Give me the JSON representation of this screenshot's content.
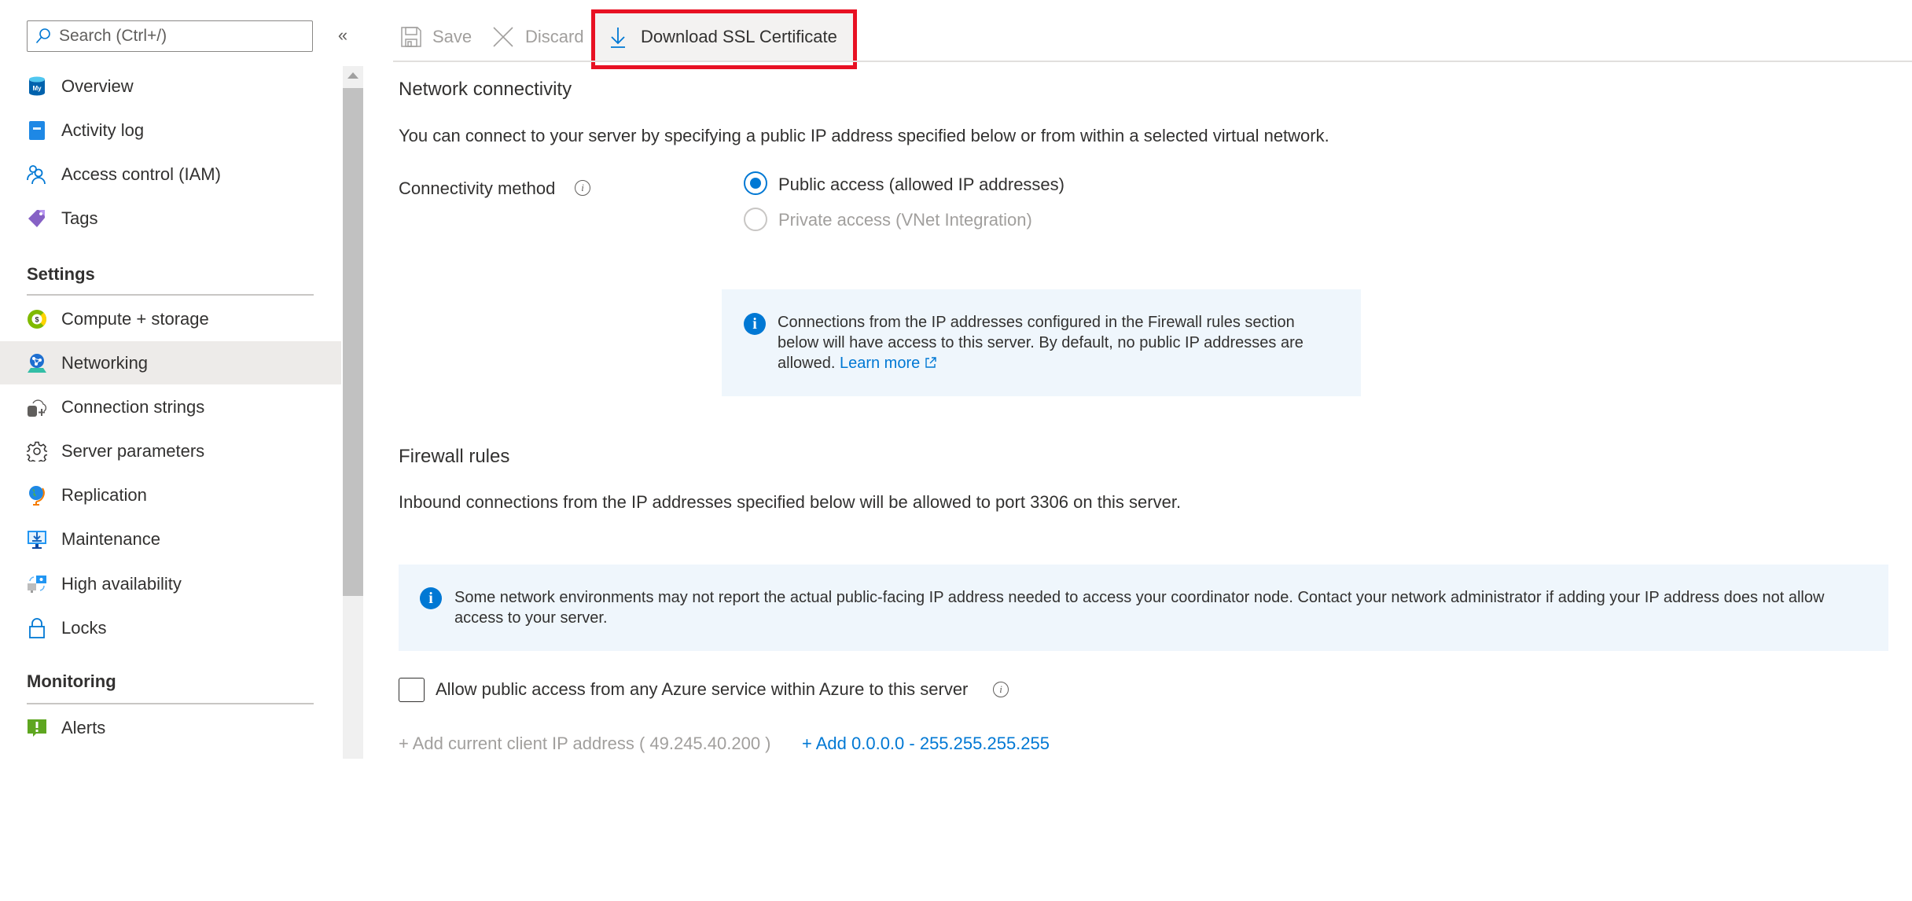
{
  "sidebar": {
    "search_placeholder": "Search (Ctrl+/)",
    "collapse_glyph": "«",
    "items_top": [
      {
        "label": "Overview",
        "icon": "mysql-database-icon"
      },
      {
        "label": "Activity log",
        "icon": "activity-log-icon"
      },
      {
        "label": "Access control (IAM)",
        "icon": "people-icon"
      },
      {
        "label": "Tags",
        "icon": "tag-icon"
      }
    ],
    "settings_heading": "Settings",
    "settings_items": [
      {
        "label": "Compute + storage",
        "icon": "compute-storage-icon"
      },
      {
        "label": "Networking",
        "icon": "networking-icon",
        "active": true
      },
      {
        "label": "Connection strings",
        "icon": "connection-strings-icon"
      },
      {
        "label": "Server parameters",
        "icon": "gear-icon"
      },
      {
        "label": "Replication",
        "icon": "globe-icon"
      },
      {
        "label": "Maintenance",
        "icon": "maintenance-icon"
      },
      {
        "label": "High availability",
        "icon": "high-availability-icon"
      },
      {
        "label": "Locks",
        "icon": "lock-icon"
      }
    ],
    "monitoring_heading": "Monitoring",
    "monitoring_items": [
      {
        "label": "Alerts",
        "icon": "alert-icon"
      }
    ]
  },
  "toolbar": {
    "save_label": "Save",
    "discard_label": "Discard",
    "download_label": "Download SSL Certificate"
  },
  "network": {
    "title": "Network connectivity",
    "description": "You can connect to your server by specifying a public IP address specified below or from within a selected virtual network.",
    "method_label": "Connectivity method",
    "options": [
      {
        "label": "Public access (allowed IP addresses)",
        "selected": true,
        "disabled": false
      },
      {
        "label": "Private access (VNet Integration)",
        "selected": false,
        "disabled": true
      }
    ],
    "info_text": "Connections from the IP addresses configured in the Firewall rules section below will have access to this server. By default, no public IP addresses are allowed.",
    "learn_more": "Learn more"
  },
  "firewall": {
    "title": "Firewall rules",
    "description": "Inbound connections from the IP addresses specified below will be allowed to port 3306 on this server.",
    "warning_text": "Some network environments may not report the actual public-facing IP address needed to access your coordinator node. Contact your network administrator if adding your IP address does not allow access to your server.",
    "allow_azure_label": "Allow public access from any Azure service within Azure to this server",
    "allow_azure_checked": false,
    "add_client_ip": "+ Add current client IP address ( 49.245.40.200 )",
    "add_all_range": "+ Add 0.0.0.0 - 255.255.255.255"
  },
  "colors": {
    "accent": "#0078d4",
    "highlight_box": "#e81123",
    "active_nav": "#edebe9",
    "info_bg": "#eff6fc"
  }
}
